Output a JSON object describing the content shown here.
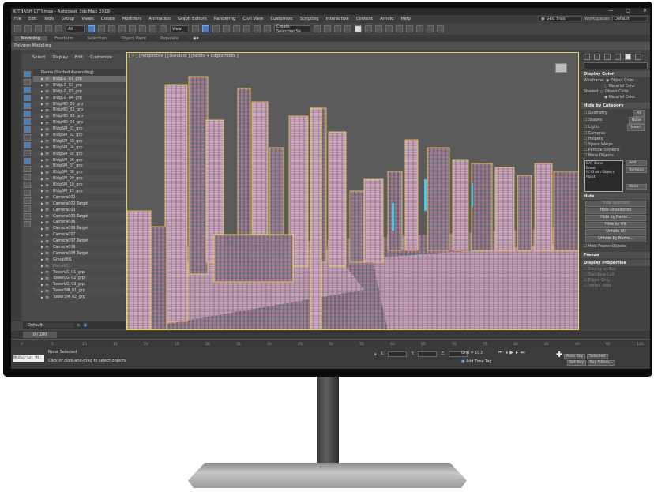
{
  "window": {
    "title": "KITBASH CITY.max - Autodesk 3ds Max 2019",
    "controls": [
      "—",
      "▢",
      "✕"
    ]
  },
  "menu": [
    "File",
    "Edit",
    "Tools",
    "Group",
    "Views",
    "Create",
    "Modifiers",
    "Animation",
    "Graph Editors",
    "Rendering",
    "Civil View",
    "Customize",
    "Scripting",
    "Interactive",
    "Content",
    "Arnold",
    "Help"
  ],
  "user": "Ged Trias",
  "workspace": {
    "label": "Workspaces:",
    "value": "Default"
  },
  "toolbar": {
    "filter": "All",
    "view": "View",
    "selection_set": "Create Selection Se"
  },
  "ribbon": {
    "tabs": [
      "Modeling",
      "Freeform",
      "Selection",
      "Object Paint",
      "Populate"
    ],
    "active": "Modeling",
    "panel": "Polygon Modeling"
  },
  "explorer": {
    "menu": [
      "Select",
      "Display",
      "Edit",
      "Customize"
    ],
    "header": "Name (Sorted Ascending)",
    "rows": [
      "BldgLG_01_grp",
      "BldgLG_02_grp",
      "BldgLG_03_grp",
      "BldgLG_04_grp",
      "BldgMD_01_grp",
      "BldgMD_02_grp",
      "BldgMD_03_grp",
      "BldgMD_04_grp",
      "BldgSM_01_grp",
      "BldgSM_02_grp",
      "BldgSM_03_grp",
      "BldgSM_04_grp",
      "BldgSM_05_grp",
      "BldgSM_06_grp",
      "BldgSM_07_grp",
      "BldgSM_08_grp",
      "BldgSM_09_grp",
      "BldgSM_10_grp",
      "BldgSM_11_grp",
      "Camera002",
      "Camera002.Target",
      "Camera003",
      "Camera003.Target",
      "Camera006",
      "Camera006.Target",
      "Camera007",
      "Camera007.Target",
      "Camera008",
      "Camera008.Target",
      "Group001",
      "Plane001",
      "TowerLG_01_grp",
      "TowerLG_02_grp",
      "TowerLG_03_grp",
      "TowerSM_01_grp",
      "TowerSM_02_grp"
    ],
    "layer": "Default"
  },
  "viewport": {
    "label": "[ + ] [Perspective ] [Standard ] [Facets + Edged Faces ]"
  },
  "command_panel": {
    "display_color": {
      "title": "Display Color",
      "wireframe_label": "Wireframe:",
      "wireframe_opts": [
        "Object Color",
        "Material Color"
      ],
      "shaded_label": "Shaded:",
      "shaded_opts": [
        "Object Color",
        "Material Color"
      ]
    },
    "hide_by_category": {
      "title": "Hide by Category",
      "items": [
        "Geometry",
        "Shapes",
        "Lights",
        "Cameras",
        "Helpers",
        "Space Warps",
        "Particle Systems",
        "Bone Objects"
      ],
      "buttons": [
        "All",
        "None",
        "Invert"
      ],
      "list": [
        "CAT Bone",
        "Bone",
        "IK Chain Object",
        "Point"
      ],
      "list_buttons": [
        "Add",
        "Remove",
        "None"
      ]
    },
    "hide": {
      "title": "Hide",
      "buttons": [
        "Hide Selected",
        "Hide Unselected",
        "Hide by Name...",
        "Hide by Hit",
        "Unhide All",
        "Unhide by Name..."
      ],
      "check": "Hide Frozen Objects"
    },
    "freeze": {
      "title": "Freeze"
    },
    "display_props": {
      "title": "Display Properties",
      "items": [
        "Display as Box",
        "Backface Cull",
        "Edges Only",
        "Vertex Ticks"
      ]
    }
  },
  "timeline": {
    "frame": "0 / 100",
    "ticks": [
      "0",
      "5",
      "10",
      "15",
      "20",
      "25",
      "30",
      "35",
      "40",
      "45",
      "50",
      "55",
      "60",
      "65",
      "70",
      "75",
      "80",
      "85",
      "90",
      "95",
      "100"
    ]
  },
  "status": {
    "maxscript": "MAXScript Mi:",
    "selection": "None Selected",
    "prompt": "Click or click-and-drag to select objects",
    "x_label": "X:",
    "y_label": "Y:",
    "z_label": "Z:",
    "grid": "Grid = 10.0",
    "add_time_tag": "Add Time Tag",
    "auto_key": "Auto Key",
    "set_key": "Set Key",
    "selected": "Selected",
    "key_filters": "Key Filters..."
  }
}
